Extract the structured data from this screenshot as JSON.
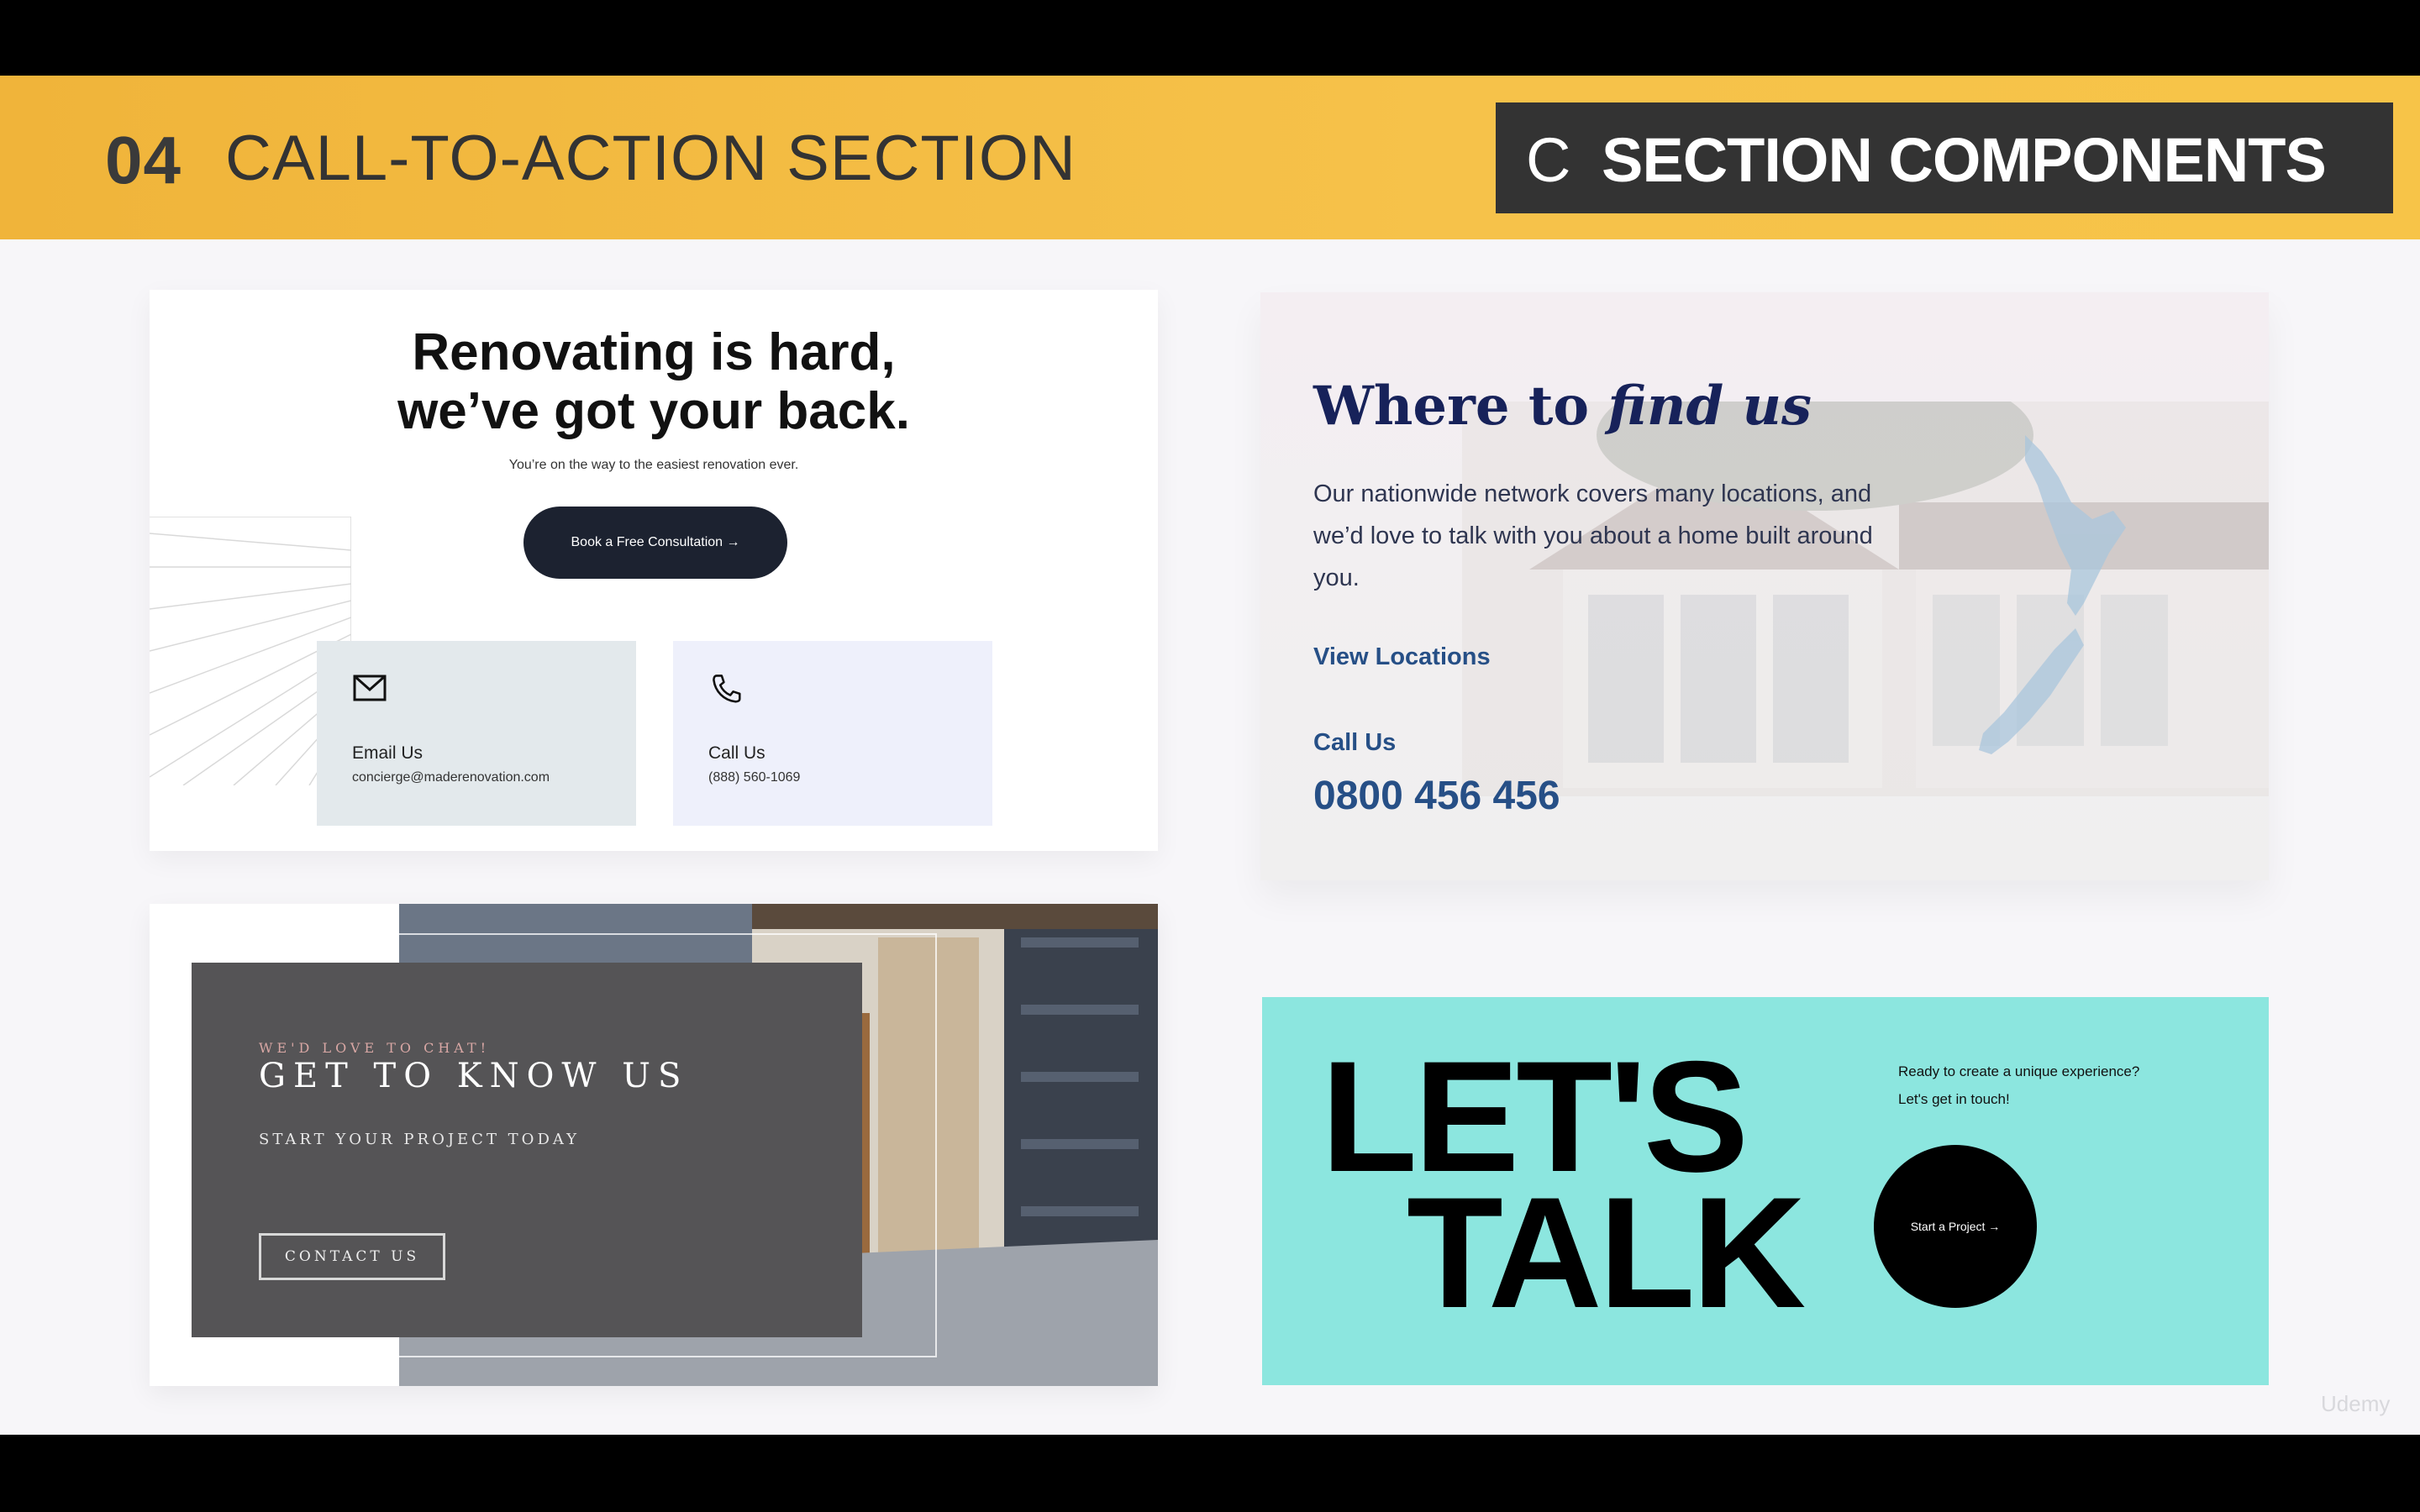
{
  "header": {
    "number": "04",
    "title": "CALL-TO-ACTION SECTION",
    "badge_letter": "C",
    "badge_text": "SECTION COMPONENTS"
  },
  "card_renovating": {
    "title_line1": "Renovating is hard,",
    "title_line2": "we’ve got your back.",
    "subtitle": "You’re on the way to the easiest renovation ever.",
    "button_label": "Book a Free Consultation →",
    "email": {
      "label": "Email Us",
      "value": "concierge@maderenovation.com",
      "icon": "envelope-icon"
    },
    "call": {
      "label": "Call Us",
      "value": "(888) 560-1069",
      "icon": "phone-icon"
    }
  },
  "card_find_us": {
    "title_plain": "Where to ",
    "title_italic": "find us",
    "body": "Our nationwide network covers many locations, and we’d love to talk with you about a home built around you.",
    "link_label": "View Locations",
    "call_label": "Call Us",
    "phone": "0800 456 456"
  },
  "card_know_us": {
    "overline": "WE'D LOVE TO CHAT!",
    "title": "GET TO KNOW US",
    "subtitle": "START YOUR PROJECT TODAY",
    "button_label": "CONTACT US"
  },
  "card_lets_talk": {
    "line1": "LET'S",
    "line2": "TALK",
    "tagline_line1": "Ready to create a unique experience?",
    "tagline_line2": "Let's get in touch!",
    "button_label": "Start a Project →"
  },
  "watermark": "Udemy",
  "colors": {
    "band": "#f6c24a",
    "badge": "#333333",
    "navy": "#17225a",
    "link_blue": "#264f86",
    "teal": "#8ce6df"
  }
}
